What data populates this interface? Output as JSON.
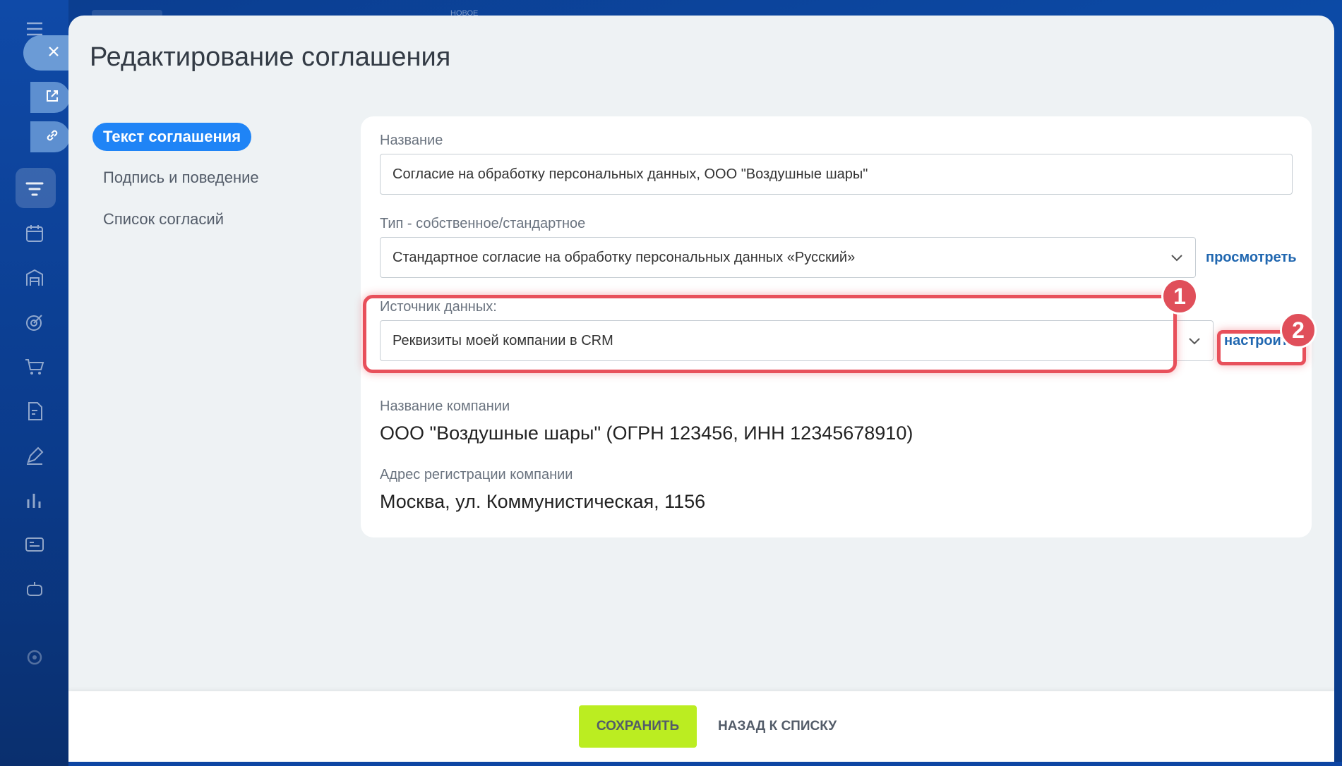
{
  "background": {
    "top_label": "НОВОЕ"
  },
  "panel": {
    "title": "Редактирование соглашения"
  },
  "nav": {
    "items": [
      {
        "label": "Текст соглашения",
        "active": true
      },
      {
        "label": "Подпись и поведение",
        "active": false
      },
      {
        "label": "Список согласий",
        "active": false
      }
    ]
  },
  "form": {
    "name_label": "Название",
    "name_value": "Согласие на обработку персональных данных, ООО \"Воздушные шары\"",
    "type_label": "Тип - собственное/стандартное",
    "type_value": "Стандартное согласие на обработку персональных данных «Русский»",
    "type_link": "просмотреть",
    "source_label": "Источник данных:",
    "source_value": "Реквизиты моей компании в CRM",
    "source_link": "настроить",
    "company_name_label": "Название компании",
    "company_name_value": "ООО \"Воздушные шары\" (ОГРН 123456, ИНН 12345678910)",
    "company_address_label": "Адрес регистрации компании",
    "company_address_value": "Москва, ул. Коммунистическая, 1156"
  },
  "annotations": {
    "badge_1": "1",
    "badge_2": "2",
    "highlight_color": "#e8505b"
  },
  "footer": {
    "save_label": "СОХРАНИТЬ",
    "back_label": "НАЗАД К СПИСКУ"
  },
  "colors": {
    "accent": "#1f84f6",
    "save_button": "#bbed21",
    "link": "#2067b0"
  }
}
